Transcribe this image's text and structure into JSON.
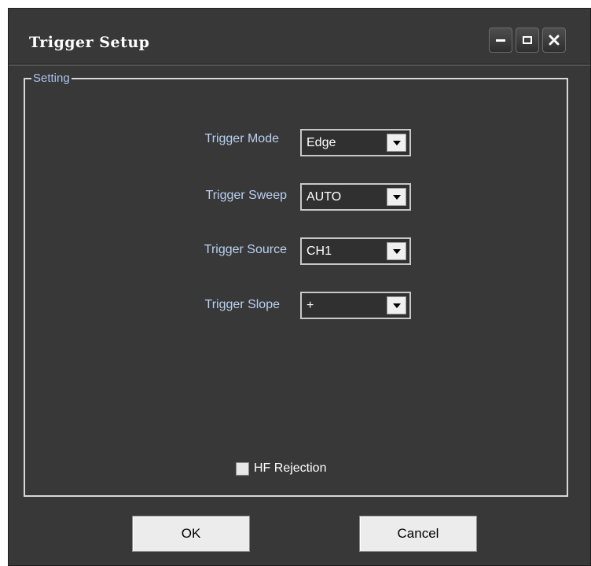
{
  "window": {
    "title": "Trigger Setup",
    "controls": {
      "minimize": "minimize-icon",
      "maximize": "maximize-icon",
      "close": "close-icon"
    }
  },
  "group": {
    "legend": "Setting",
    "fields": [
      {
        "label": "Trigger Mode",
        "value": "Edge"
      },
      {
        "label": "Trigger Sweep",
        "value": "AUTO"
      },
      {
        "label": "Trigger Source",
        "value": "CH1"
      },
      {
        "label": "Trigger Slope",
        "value": "+"
      }
    ],
    "hf_rejection": {
      "label": "HF Rejection",
      "checked": false
    }
  },
  "buttons": {
    "ok": "OK",
    "cancel": "Cancel"
  },
  "colors": {
    "background": "#383838",
    "label_text": "#b9d1f0",
    "legend_text": "#a9c5ea"
  }
}
